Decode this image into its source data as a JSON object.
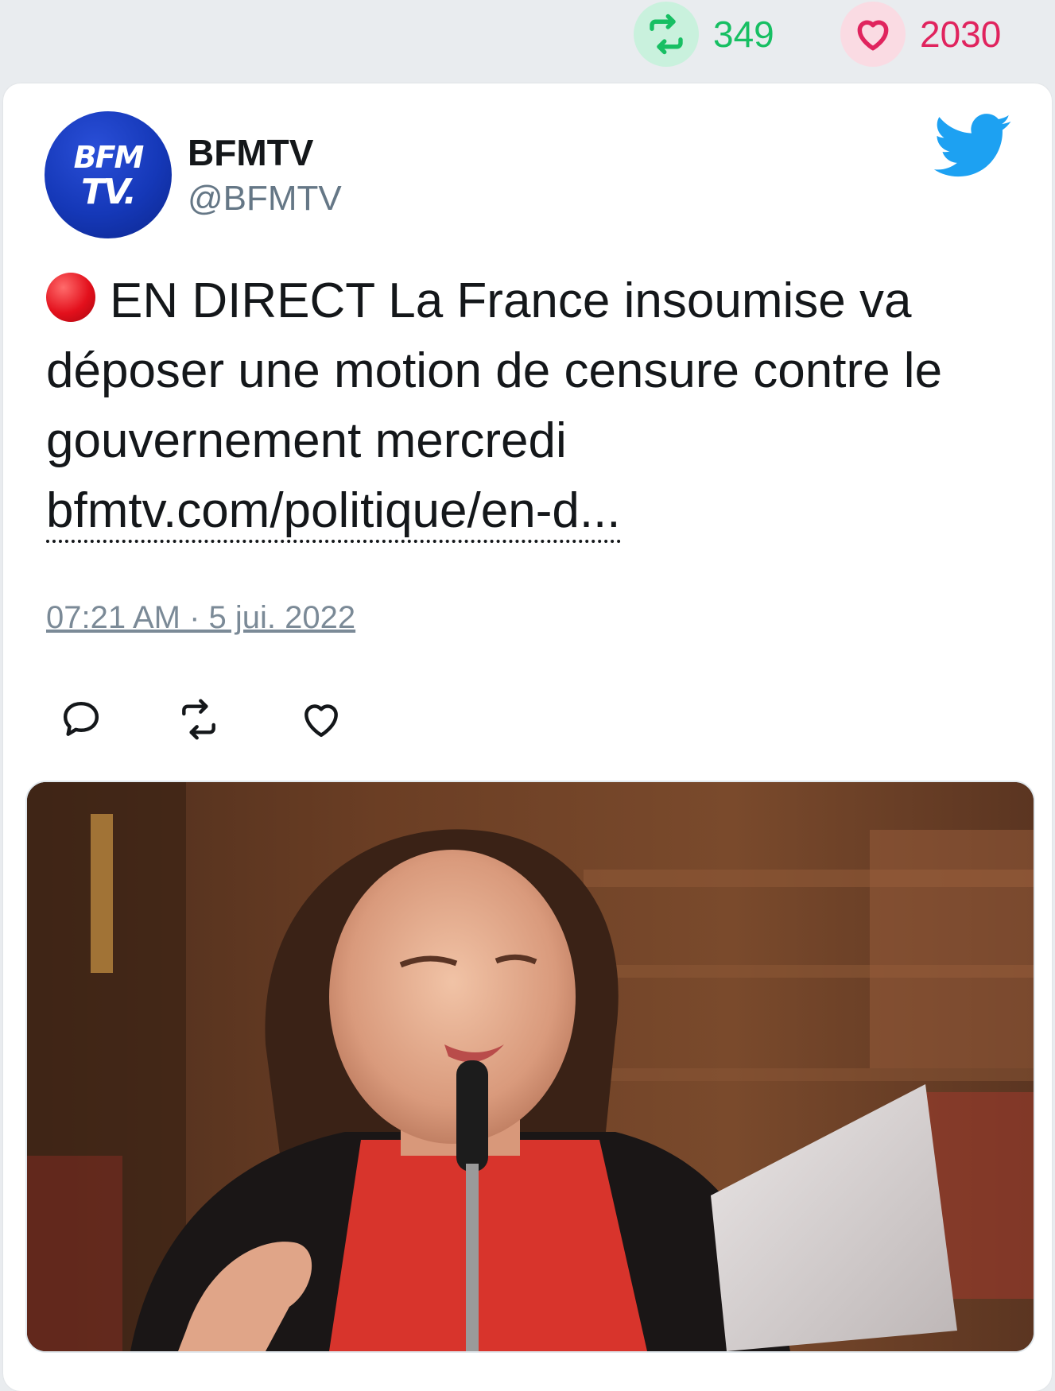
{
  "stats": {
    "retweets": "349",
    "likes": "2030",
    "retweet_icon": "retweet-icon",
    "like_icon": "heart-icon",
    "retweet_color": "#17bf63",
    "like_color": "#e0245e"
  },
  "tweet": {
    "author_name": "BFMTV",
    "author_handle": "@BFMTV",
    "avatar_text_line1": "BFM",
    "avatar_text_line2": "TV.",
    "live_icon": "red-circle-icon",
    "text": "EN DIRECT La France insoumise va déposer une motion de censure contre le gouvernement mercredi",
    "link": "bfmtv.com/politique/en-d...",
    "timestamp": "07:21 AM · 5 jui. 2022",
    "platform_icon": "twitter-bird-icon",
    "accent_color": "#1da1f2"
  },
  "actions": {
    "reply_icon": "reply-icon",
    "retweet_icon": "retweet-icon",
    "like_icon": "heart-icon"
  },
  "media": {
    "description_icon": "photo-image"
  }
}
